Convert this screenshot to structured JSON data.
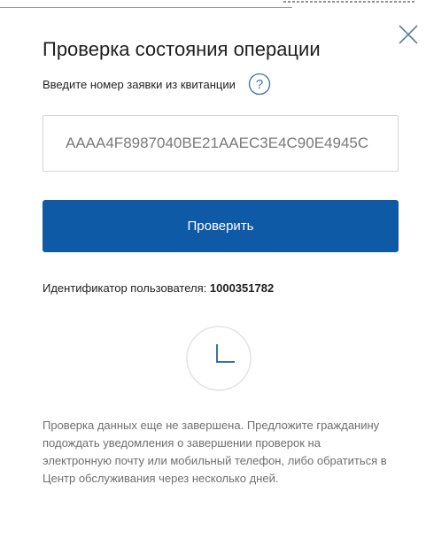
{
  "dialog": {
    "title": "Проверка состояния операции",
    "hint_label": "Введите номер заявки из квитанции",
    "help_icon": "question-mark-circle-icon",
    "close_icon": "close-x-icon",
    "request_input": {
      "value": "AAAA4F8987040BE21AAEC3E4C90E4945C",
      "placeholder": ""
    },
    "check_button_label": "Проверить",
    "user_id_label": "Идентификатор пользователя:",
    "user_id_value": "1000351782",
    "status_icon": "clock-icon",
    "status_message": "Проверка данных еще не завершена. Предложите гражданину подождать уведомления о завершении проверок на электронную почту или мобильный телефон, либо обратиться в Центр обслуживания через несколько дней."
  },
  "colors": {
    "accent": "#0f5aa7",
    "icon_blue": "#3a6fb0",
    "text": "#1f1f1f",
    "muted_text": "#6f6f6f"
  }
}
